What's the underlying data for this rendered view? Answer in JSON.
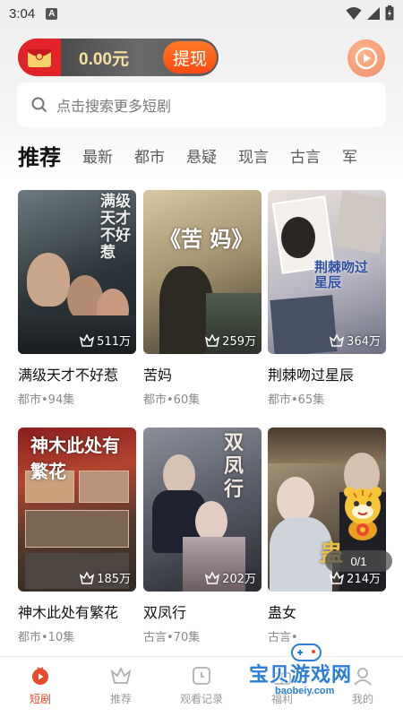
{
  "status_bar": {
    "time": "3:04",
    "notif_letter": "A"
  },
  "wallet": {
    "amount": "0.00元",
    "withdraw_label": "提现"
  },
  "search": {
    "placeholder": "点击搜索更多短剧"
  },
  "tabs": [
    "推荐",
    "最新",
    "都市",
    "悬疑",
    "现言",
    "古言",
    "军"
  ],
  "active_tab": "推荐",
  "dramas": [
    {
      "title": "满级天才不好惹",
      "genre": "都市",
      "episodes": "94集",
      "meta": "都市•94集",
      "views": "511万",
      "poster_art": "满级天才不好惹"
    },
    {
      "title": "苦妈",
      "genre": "都市",
      "episodes": "60集",
      "meta": "都市•60集",
      "views": "259万",
      "poster_art": "《苦 妈》"
    },
    {
      "title": "荆棘吻过星辰",
      "genre": "都市",
      "episodes": "65集",
      "meta": "都市•65集",
      "views": "364万",
      "poster_art": "荆棘吻过星辰"
    },
    {
      "title": "神木此处有繁花",
      "genre": "都市",
      "episodes": "10集",
      "meta": "都市•10集",
      "views": "185万",
      "poster_art": "神木此处有繁花"
    },
    {
      "title": "双凤行",
      "genre": "古言",
      "episodes": "70集",
      "meta": "古言•70集",
      "views": "202万",
      "poster_art": "双凤行"
    },
    {
      "title": "蛊女",
      "genre": "古言",
      "episodes": "",
      "meta": "古言•",
      "views": "214万",
      "poster_art": "蛊"
    }
  ],
  "floating_progress": "0/1",
  "bottom_nav": [
    {
      "label": "短剧",
      "icon": "tv-icon",
      "active": true
    },
    {
      "label": "推荐",
      "icon": "crown-icon",
      "active": false
    },
    {
      "label": "观看记录",
      "icon": "history-icon",
      "active": false
    },
    {
      "label": "福利",
      "icon": "gift-icon",
      "active": false
    },
    {
      "label": "我的",
      "icon": "user-icon",
      "active": false
    }
  ],
  "watermark": {
    "text": "宝贝游戏网",
    "url": "baobeiy.com"
  },
  "colors": {
    "accent": "#e84a2c",
    "withdraw": "#ff5a1c",
    "wallet_text": "#f5e0a0"
  }
}
